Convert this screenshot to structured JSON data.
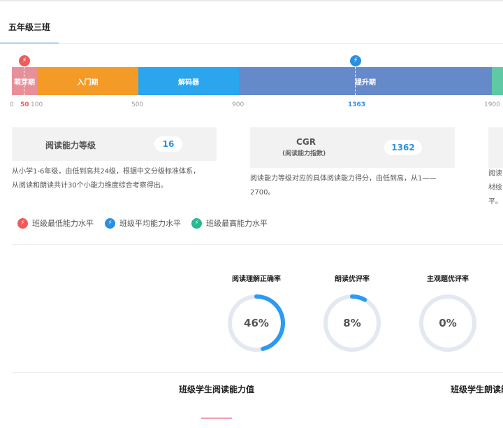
{
  "class_tab": "五年级三班",
  "markers": {
    "low_icon": "lightning-icon",
    "avg_icon": "lightning-icon"
  },
  "scale": {
    "segments": [
      {
        "label": "萌芽期",
        "color": "#e8909a"
      },
      {
        "label": "入门期",
        "color": "#f39b26"
      },
      {
        "label": "解码器",
        "color": "#2aa5ee"
      },
      {
        "label": "提升期",
        "color": "#6589c9"
      }
    ],
    "ticks": [
      "0",
      "100",
      "500",
      "900",
      "1900"
    ],
    "low_value": "50",
    "avg_value": "1363"
  },
  "cards": [
    {
      "label": "阅读能力等级",
      "value": "16",
      "desc_line1": "从小学1-6年级，由低到高共24级，根据中文分级标准体系，",
      "desc_line2": "从阅读和朗读共计30个小能力维度综合考察得出。"
    },
    {
      "label": "CGR",
      "sublabel": "(阅读能力指数)",
      "value": "1362",
      "desc_line1": "阅读能力等级对应的具体阅读能力得分，由低到高，从1——",
      "desc_line2": "2700。"
    },
    {
      "desc_line1": "阅读",
      "desc_line2": "材绘",
      "desc_line3": "平。"
    }
  ],
  "legend": [
    {
      "label": "班级最低能力水平",
      "color": "#ef5b5b"
    },
    {
      "label": "班级平均能力水平",
      "color": "#2b8fe0"
    },
    {
      "label": "班级最高能力水平",
      "color": "#29b892"
    }
  ],
  "gauges": [
    {
      "title": "阅读理解正确率",
      "value": "46%",
      "fraction": 0.46
    },
    {
      "title": "朗读优评率",
      "value": "8%",
      "fraction": 0.08
    },
    {
      "title": "主观题优评率",
      "value": "0%",
      "fraction": 0
    }
  ],
  "bottom": {
    "left_title": "班级学生阅读能力值",
    "right_title": "班级学生朗读能"
  }
}
